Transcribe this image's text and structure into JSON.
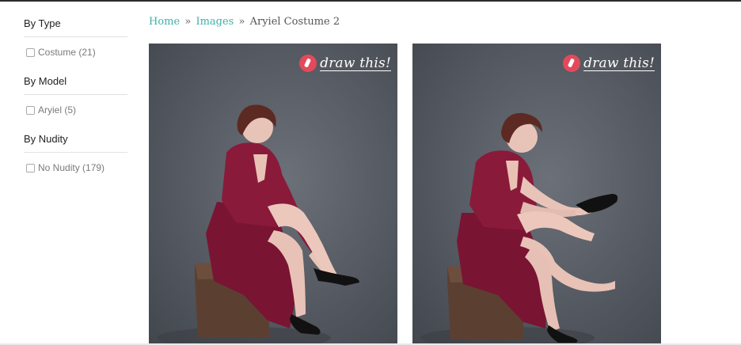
{
  "sidebar": {
    "groups": [
      {
        "title": "By Type",
        "option": "Costume (21)"
      },
      {
        "title": "By Model",
        "option": "Aryiel (5)"
      },
      {
        "title": "By Nudity",
        "option": "No Nudity (179)"
      }
    ]
  },
  "breadcrumb": {
    "home": "Home",
    "images": "Images",
    "separator": "»",
    "current": "Aryiel Costume 2"
  },
  "photos": [
    {
      "watermark": "draw this!",
      "icon": "draw-this-logo-icon"
    },
    {
      "watermark": "draw this!",
      "icon": "draw-this-logo-icon"
    }
  ],
  "colors": {
    "link": "#3fb1a9",
    "dress": "#8a1a3a",
    "backdrop": "#555961",
    "watermark_badge": "#e24a5b"
  }
}
